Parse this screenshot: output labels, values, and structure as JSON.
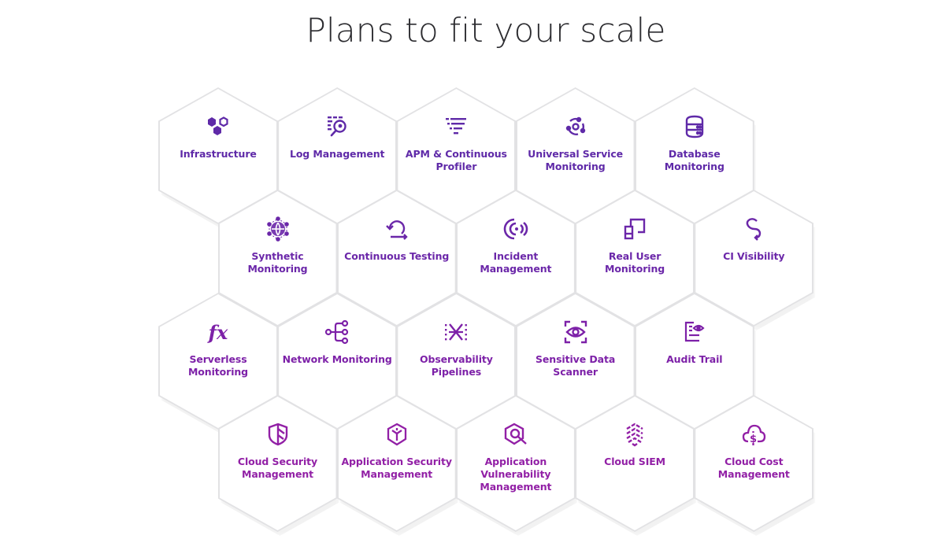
{
  "header": {
    "title": "Plans to fit your scale"
  },
  "colors": {
    "row1": "#5f2aa8",
    "row2": "#6b27a9",
    "row3": "#7d21a8",
    "row4": "#9220a6",
    "hex_fill": "#ffffff",
    "hex_border": "#e2e2e4",
    "title": "#2c2c30"
  },
  "products": [
    {
      "label": "Infrastructure",
      "icon": "hexagons-icon",
      "row": 1
    },
    {
      "label": "Log Management",
      "icon": "log-search-icon",
      "row": 1
    },
    {
      "label": "APM & Continuous Profiler",
      "icon": "apm-filter-icon",
      "row": 1
    },
    {
      "label": "Universal Service Monitoring",
      "icon": "service-cycle-icon",
      "row": 1
    },
    {
      "label": "Database Monitoring",
      "icon": "database-icon",
      "row": 1
    },
    {
      "label": "Synthetic Monitoring",
      "icon": "globe-network-icon",
      "row": 2
    },
    {
      "label": "Continuous Testing",
      "icon": "loop-arrow-icon",
      "row": 2
    },
    {
      "label": "Incident Management",
      "icon": "signal-radio-icon",
      "row": 2
    },
    {
      "label": "Real User Monitoring",
      "icon": "devices-icon",
      "row": 2
    },
    {
      "label": "CI Visibility",
      "icon": "pipeline-s-icon",
      "row": 2
    },
    {
      "label": "Serverless Monitoring",
      "icon": "function-fx-icon",
      "row": 3
    },
    {
      "label": "Network Monitoring",
      "icon": "network-nodes-icon",
      "row": 3
    },
    {
      "label": "Observability Pipelines",
      "icon": "pipelines-cross-icon",
      "row": 3
    },
    {
      "label": "Sensitive Data Scanner",
      "icon": "eye-scan-icon",
      "row": 3
    },
    {
      "label": "Audit Trail",
      "icon": "audit-document-icon",
      "row": 3
    },
    {
      "label": "Cloud Security Management",
      "icon": "shield-icon",
      "row": 4
    },
    {
      "label": "Application Security Management",
      "icon": "hex-shield-icon",
      "row": 4
    },
    {
      "label": "Application Vulnerability Management",
      "icon": "vuln-search-icon",
      "row": 4
    },
    {
      "label": "Cloud SIEM",
      "icon": "siem-chevrons-icon",
      "row": 4
    },
    {
      "label": "Cloud Cost Management",
      "icon": "cloud-dollar-icon",
      "row": 4
    }
  ]
}
